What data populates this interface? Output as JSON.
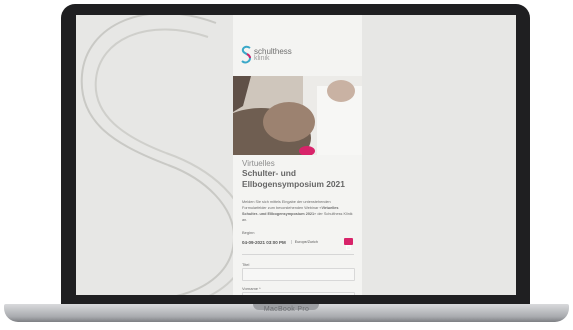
{
  "device": {
    "label": "MacBook Pro"
  },
  "colors": {
    "accent": "#d8246a",
    "brand_teal": "#3aa8c8",
    "brand_pink": "#d8246a"
  },
  "form": {
    "brand": {
      "name": "schulthess",
      "sub": "klinik"
    },
    "title": {
      "line1": "Virtuelles",
      "line2": "Schulter- und Ellbogensymposium 2021"
    },
    "intro": {
      "part1": "Melden Sie sich mittels Eingabe der untenstehenden Formularfelder zum bevorstehenden Webinar «",
      "bold": "Virtuelles Schulter- und Ellbogensymposium 2021",
      "part2": "» der Schulthess Klinik an."
    },
    "begin": {
      "label": "Beginn",
      "datetime": "04-09-2021 03:00 PM",
      "timezone": "Europe/Zurich",
      "calendar_icon": "calendar-icon"
    },
    "fields": {
      "title_label": "Titel",
      "firstname_label": "Vorname *"
    }
  }
}
